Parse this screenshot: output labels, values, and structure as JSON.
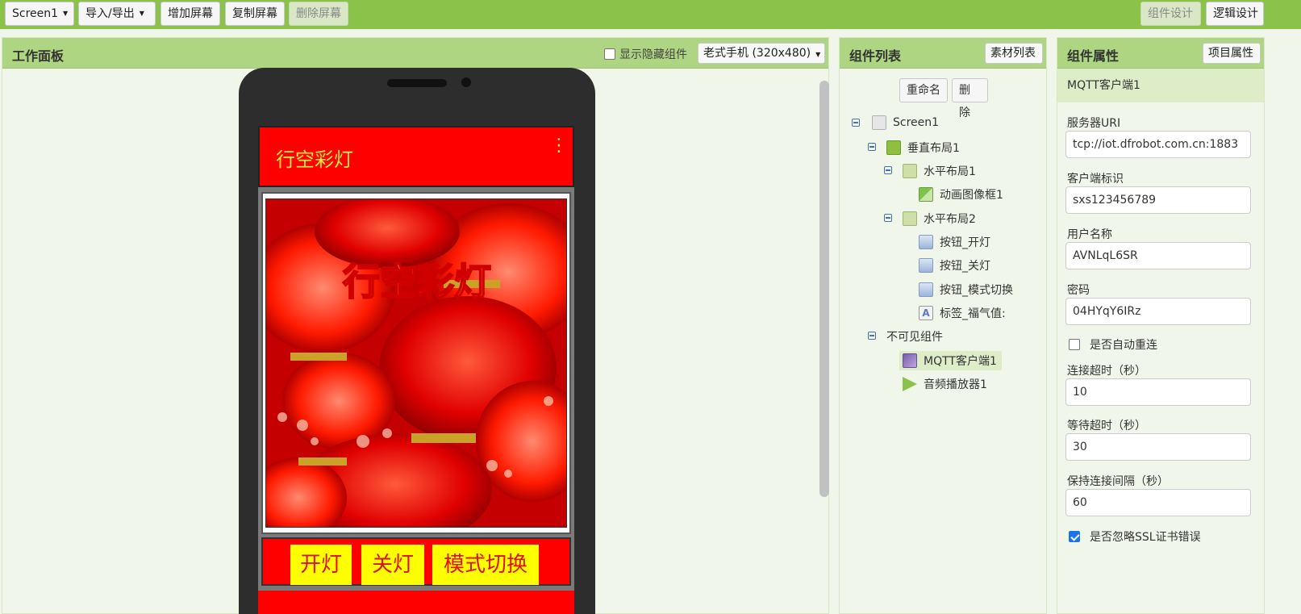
{
  "toolbar": {
    "screen_select": "Screen1",
    "import_export": "导入/导出",
    "add_screen": "增加屏幕",
    "copy_screen": "复制屏幕",
    "delete_screen": "删除屏幕",
    "designer": "组件设计",
    "blocks": "逻辑设计"
  },
  "workspace": {
    "title": "工作面板",
    "show_hidden_label": "显示隐藏组件",
    "show_hidden_checked": false,
    "device_select": "老式手机 (320x480)",
    "app": {
      "title": "行空彩灯",
      "image_title": "行空彩灯",
      "buttons": [
        "开灯",
        "关灯",
        "模式切换"
      ]
    }
  },
  "components": {
    "title": "组件列表",
    "media_button": "素材列表",
    "rename_button": "重命名",
    "delete_button": "删除",
    "tree": [
      {
        "label": "Screen1",
        "icon": "screen-icon"
      },
      {
        "label": "垂直布局1",
        "icon": "vertical-layout-icon"
      },
      {
        "label": "水平布局1",
        "icon": "horizontal-layout-icon"
      },
      {
        "label": "动画图像框1",
        "icon": "image-icon"
      },
      {
        "label": "水平布局2",
        "icon": "horizontal-layout-icon"
      },
      {
        "label": "按钮_开灯",
        "icon": "button-icon"
      },
      {
        "label": "按钮_关灯",
        "icon": "button-icon"
      },
      {
        "label": "按钮_模式切换",
        "icon": "button-icon"
      },
      {
        "label": "标签_福气值:",
        "icon": "label-icon"
      },
      {
        "label": "不可见组件",
        "icon": ""
      },
      {
        "label": "MQTT客户端1",
        "icon": "mqtt-icon",
        "selected": true
      },
      {
        "label": "音频播放器1",
        "icon": "player-icon"
      }
    ]
  },
  "properties": {
    "title": "组件属性",
    "project_button": "项目属性",
    "component_name": "MQTT客户端1",
    "fields": [
      {
        "label": "服务器URI",
        "value": "tcp://iot.dfrobot.com.cn:1883"
      },
      {
        "label": "客户端标识",
        "value": "sxs123456789"
      },
      {
        "label": "用户名称",
        "value": "AVNLqL6SR"
      },
      {
        "label": "密码",
        "value": "04HYqY6IRz"
      }
    ],
    "auto_reconnect_label": "是否自动重连",
    "auto_reconnect": false,
    "timeout_fields": [
      {
        "label": "连接超时（秒）",
        "value": "10"
      },
      {
        "label": "等待超时（秒）",
        "value": "30"
      },
      {
        "label": "保持连接间隔（秒）",
        "value": "60"
      }
    ],
    "ignore_ssl_label": "是否忽略SSL证书错误",
    "ignore_ssl": true
  },
  "colors": {
    "toolbar": "#8bc34a",
    "panel_header": "#aed581",
    "app_red": "#ff0000",
    "app_yellow": "#ffff00"
  }
}
